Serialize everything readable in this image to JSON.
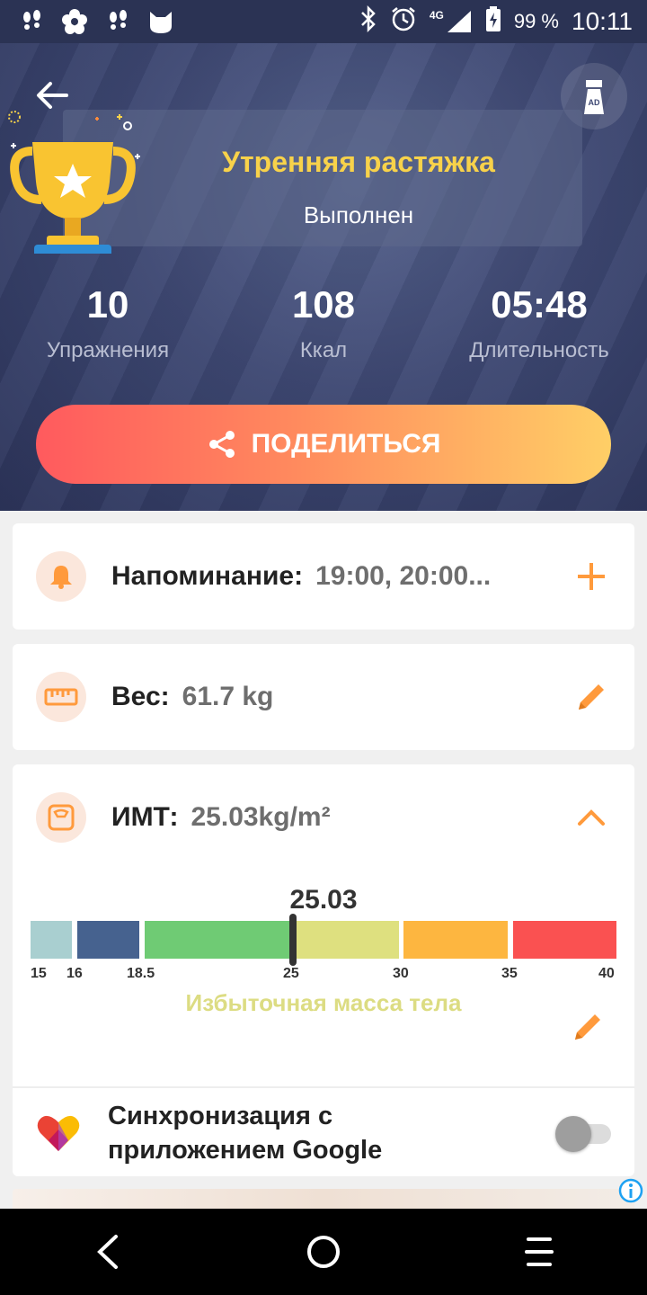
{
  "status_bar": {
    "battery": "99 %",
    "time": "10:11",
    "network": "4G"
  },
  "header": {
    "title": "Утренняя растяжка",
    "subtitle": "Выполнен",
    "stats": [
      {
        "value": "10",
        "label": "Упражнения"
      },
      {
        "value": "108",
        "label": "Ккал"
      },
      {
        "value": "05:48",
        "label": "Длительность"
      }
    ],
    "share_label": "ПОДЕЛИТЬСЯ",
    "ad_badge": "AD"
  },
  "reminder": {
    "label": "Напоминание:",
    "value": "19:00, 20:00..."
  },
  "weight": {
    "label": "Вес:",
    "value": "61.7 kg"
  },
  "bmi": {
    "label": "ИМТ:",
    "value": "25.03kg/m²",
    "number": "25.03",
    "bmi_value": 25.03,
    "status": "Избыточная масса тела",
    "scale_ticks": [
      "15",
      "16",
      "18.5",
      "25",
      "30",
      "35",
      "40"
    ],
    "segment_colors": [
      "#a9cfd0",
      "#46628f",
      "#6fcb74",
      "#dee07f",
      "#fdb640",
      "#fa5151"
    ]
  },
  "sync": {
    "label": "Синхронизация с приложением Google",
    "enabled": false
  },
  "colors": {
    "accent": "#ff9a3c",
    "title": "#f8d24a"
  }
}
